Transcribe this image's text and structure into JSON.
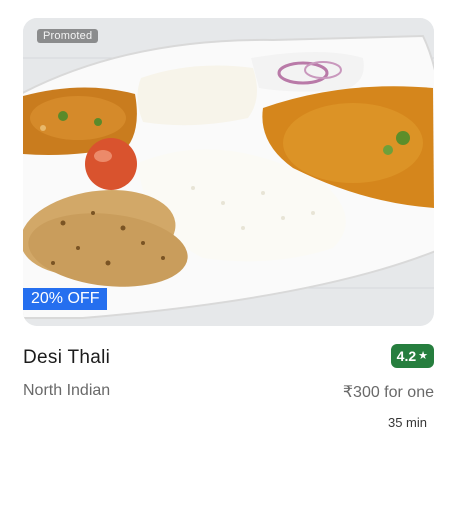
{
  "card": {
    "promoted_label": "Promoted",
    "offer_label": "20% OFF",
    "restaurant_name": "Desi Thali",
    "rating": "4.2",
    "rating_icon": "star-icon",
    "cuisine": "North Indian",
    "cost": "₹300 for one",
    "delivery_time": "35 min",
    "image_icon": "food-thali-image"
  },
  "colors": {
    "offer_badge": "#256fef",
    "rating_badge": "#267e3e",
    "text_primary": "#1c1c1c",
    "text_secondary": "#696969"
  }
}
